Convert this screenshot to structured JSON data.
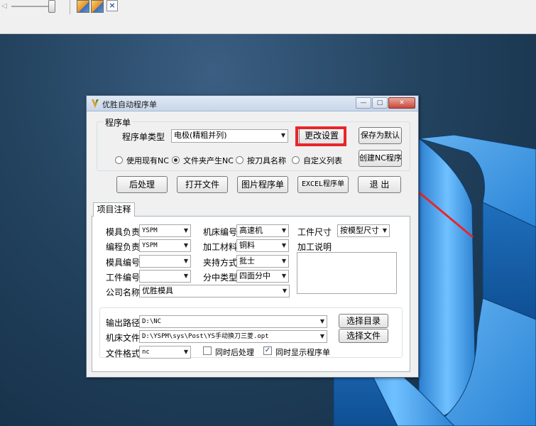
{
  "colors": {
    "highlight": "#e8262b",
    "model_blue": "#2f8fe0"
  },
  "toolbar": {
    "icons": [
      "slider-arrow-icon",
      "module-icon-1",
      "module-icon-2"
    ],
    "close_glyph": "×"
  },
  "dialog": {
    "title": "优胜自动程序单",
    "window_buttons": {
      "minimize": "—",
      "maximize": "□",
      "close": "✕"
    },
    "group_program": {
      "legend": "程序单",
      "type_label": "程序单类型",
      "type_value": "电极(精粗并列)",
      "change_settings_button": "更改设置",
      "save_default_button": "保存为默认",
      "radios": [
        {
          "label": "使用现有NC",
          "checked": false
        },
        {
          "label": "文件夹产生NC",
          "checked": true
        },
        {
          "label": "按刀具名称",
          "checked": false
        },
        {
          "label": "自定义列表",
          "checked": false
        }
      ],
      "create_nc_button": "创建NC程序"
    },
    "actions": [
      "后处理",
      "打开文件",
      "图片程序单",
      "EXCEL程序单",
      "退 出"
    ],
    "tab_label": "项目注释",
    "fields": {
      "mold_owner": {
        "label": "模具负责",
        "value": "YSPM"
      },
      "programmer": {
        "label": "编程负责",
        "value": "YSPM"
      },
      "mold_number": {
        "label": "模具编号",
        "value": ""
      },
      "part_number": {
        "label": "工件编号",
        "value": ""
      },
      "company": {
        "label": "公司名称",
        "value": "优胜模具"
      },
      "machine_number": {
        "label": "机床编号",
        "value": "高速机"
      },
      "material": {
        "label": "加工材料",
        "value": "铜料"
      },
      "clamping": {
        "label": "夹持方式",
        "value": "批士"
      },
      "centering": {
        "label": "分中类型",
        "value": "四面分中"
      },
      "part_size": {
        "label": "工件尺寸",
        "value": "按模型尺寸"
      },
      "notes_label": "加工说明"
    },
    "output": {
      "path_label": "输出路径",
      "path_value": "D:\\NC",
      "machine_file_label": "机床文件",
      "machine_file_value": "D:\\YSPM\\sys\\Post\\YS手动换刀三菱.opt",
      "format_label": "文件格式",
      "format_value": "nc",
      "select_dir_button": "选择目录",
      "select_file_button": "选择文件",
      "post_process_check": {
        "label": "同时后处理",
        "checked": false
      },
      "show_sheet_check": {
        "label": "同时显示程序单",
        "checked": true,
        "mark": "✓"
      }
    }
  }
}
